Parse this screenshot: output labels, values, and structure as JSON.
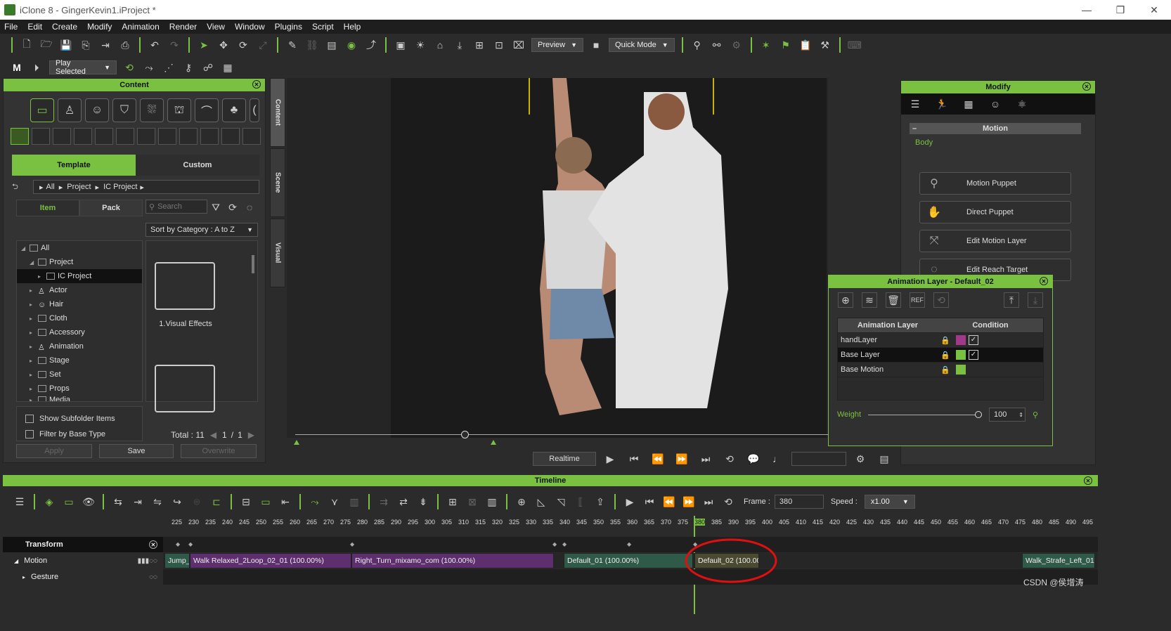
{
  "window": {
    "title": "iClone 8 - GingerKevin1.iProject *"
  },
  "menu": [
    "File",
    "Edit",
    "Create",
    "Modify",
    "Animation",
    "Render",
    "View",
    "Window",
    "Plugins",
    "Script",
    "Help"
  ],
  "toolbar": {
    "preview": "Preview",
    "quick_mode": "Quick Mode",
    "play_selected": "Play Selected"
  },
  "content": {
    "title": "Content",
    "tab_template": "Template",
    "tab_custom": "Custom",
    "breadcrumb": [
      "All",
      "Project",
      "IC Project"
    ],
    "tab_item": "Item",
    "tab_pack": "Pack",
    "search_placeholder": "Search",
    "sort": "Sort by Category : A to Z",
    "tree": [
      {
        "label": "All",
        "level": 0,
        "open": true
      },
      {
        "label": "Project",
        "level": 1,
        "open": true
      },
      {
        "label": "IC Project",
        "level": 2,
        "selected": true
      },
      {
        "label": "Actor",
        "level": 1
      },
      {
        "label": "Hair",
        "level": 1
      },
      {
        "label": "Cloth",
        "level": 1
      },
      {
        "label": "Accessory",
        "level": 1
      },
      {
        "label": "Animation",
        "level": 1
      },
      {
        "label": "Stage",
        "level": 1
      },
      {
        "label": "Set",
        "level": 1
      },
      {
        "label": "Props",
        "level": 1
      },
      {
        "label": "Media",
        "level": 1
      }
    ],
    "folder1_label": "1.Visual Effects",
    "show_subfolder": "Show Subfolder Items",
    "filter_base": "Filter by Base Type",
    "total": "Total : 11",
    "page_current": "1",
    "page_sep": "/",
    "page_total": "1",
    "btn_apply": "Apply",
    "btn_save": "Save",
    "btn_overwrite": "Overwrite"
  },
  "side_tabs": {
    "content": "Content",
    "scene": "Scene",
    "visual": "Visual"
  },
  "modify": {
    "title": "Modify",
    "section": "Motion",
    "group": "Body",
    "buttons": [
      "Motion Puppet",
      "Direct Puppet",
      "Edit Motion Layer",
      "Edit Reach Target"
    ]
  },
  "anim_layer": {
    "title": "Animation Layer - Default_02",
    "col_layer": "Animation Layer",
    "col_condition": "Condition",
    "rows": [
      {
        "name": "handLayer",
        "color": "#a0398a",
        "checked": true
      },
      {
        "name": "Base Layer",
        "color": "#7ac142",
        "checked": true
      },
      {
        "name": "Base Motion",
        "color": "#7ac142",
        "checked": false
      }
    ],
    "weight_label": "Weight",
    "weight_value": "100"
  },
  "playback": {
    "realtime": "Realtime"
  },
  "timeline": {
    "title": "Timeline",
    "frame_label": "Frame :",
    "frame_value": "380",
    "speed_label": "Speed :",
    "speed_value": "x1.00",
    "ruler": [
      "225",
      "230",
      "235",
      "240",
      "245",
      "250",
      "255",
      "260",
      "265",
      "270",
      "275",
      "280",
      "285",
      "290",
      "295",
      "300",
      "305",
      "310",
      "315",
      "320",
      "325",
      "330",
      "335",
      "340",
      "345",
      "350",
      "355",
      "360",
      "365",
      "370",
      "375",
      "380",
      "385",
      "390",
      "395",
      "400",
      "405",
      "410",
      "415",
      "420",
      "425",
      "430",
      "435",
      "440",
      "445",
      "450",
      "455",
      "460",
      "465",
      "470",
      "475",
      "480",
      "485",
      "490",
      "495"
    ],
    "tracks": {
      "transform": "Transform",
      "motion": "Motion",
      "gesture": "Gesture"
    },
    "clips": [
      {
        "label": "Jump_",
        "color": "#2f5a4a"
      },
      {
        "label": "Walk Relaxed_2Loop_02_01 (100.00%)",
        "color": "#5e2f6e"
      },
      {
        "label": "Right_Turn_mixamo_com (100.00%)",
        "color": "#5e2f6e"
      },
      {
        "label": "Default_01 (100.00%)",
        "color": "#2f5a4a"
      },
      {
        "label": "Default_02 (100.00%",
        "color": "#4a4a30"
      },
      {
        "label": "Walk_Strafe_Left_01",
        "color": "#2f5a4a"
      }
    ]
  },
  "watermark": "CSDN @侯增涛"
}
